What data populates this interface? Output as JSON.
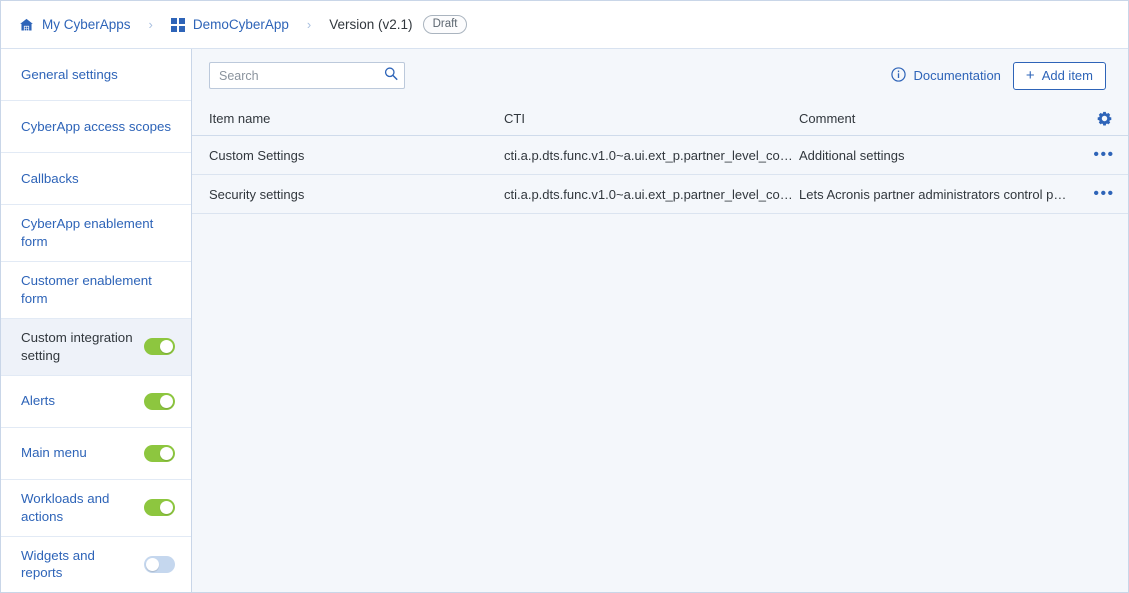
{
  "breadcrumb": {
    "items": [
      {
        "label": "My CyberApps",
        "icon": "home-icon",
        "current": false
      },
      {
        "label": "DemoCyberApp",
        "icon": "grid-icon",
        "current": false
      },
      {
        "label": "Version (v2.1)",
        "icon": "",
        "current": true
      }
    ],
    "separator": "›",
    "badge": "Draft"
  },
  "sidebar": {
    "items": [
      {
        "label": "General settings",
        "toggle": null,
        "selected": false
      },
      {
        "label": "CyberApp access scopes",
        "toggle": null,
        "selected": false
      },
      {
        "label": "Callbacks",
        "toggle": null,
        "selected": false
      },
      {
        "label": "CyberApp enablement form",
        "toggle": null,
        "selected": false
      },
      {
        "label": "Customer enablement form",
        "toggle": null,
        "selected": false
      },
      {
        "label": "Custom integration setting",
        "toggle": "on",
        "selected": true
      },
      {
        "label": "Alerts",
        "toggle": "on",
        "selected": false
      },
      {
        "label": "Main menu",
        "toggle": "on",
        "selected": false
      },
      {
        "label": "Workloads and actions",
        "toggle": "on",
        "selected": false
      },
      {
        "label": "Widgets and reports",
        "toggle": "off",
        "selected": false
      }
    ]
  },
  "toolbar": {
    "search_value": "",
    "search_placeholder": "Search",
    "search_icon": "search-icon",
    "documentation_label": "Documentation",
    "documentation_icon": "info-circle-icon",
    "add_item_label": "Add item",
    "add_item_plus": "+"
  },
  "table": {
    "columns": [
      "Item name",
      "CTI",
      "Comment"
    ],
    "settings_icon": "gear-icon",
    "row_menu_glyph": "•••",
    "rows": [
      {
        "name": "Custom Settings",
        "cti": "cti.a.p.dts.func.v1.0~a.ui.ext_p.partner_level_co…",
        "comment": "Additional settings"
      },
      {
        "name": "Security settings",
        "cti": "cti.a.p.dts.func.v1.0~a.ui.ext_p.partner_level_co…",
        "comment": "Lets Acronis partner administrators control pas…"
      }
    ]
  },
  "colors": {
    "link": "#2e64b8",
    "toggle_on": "#8dc63f",
    "toggle_off": "#c5d7ee",
    "page_bg": "#f4f7fb",
    "selected_bg": "#eef2f9"
  }
}
